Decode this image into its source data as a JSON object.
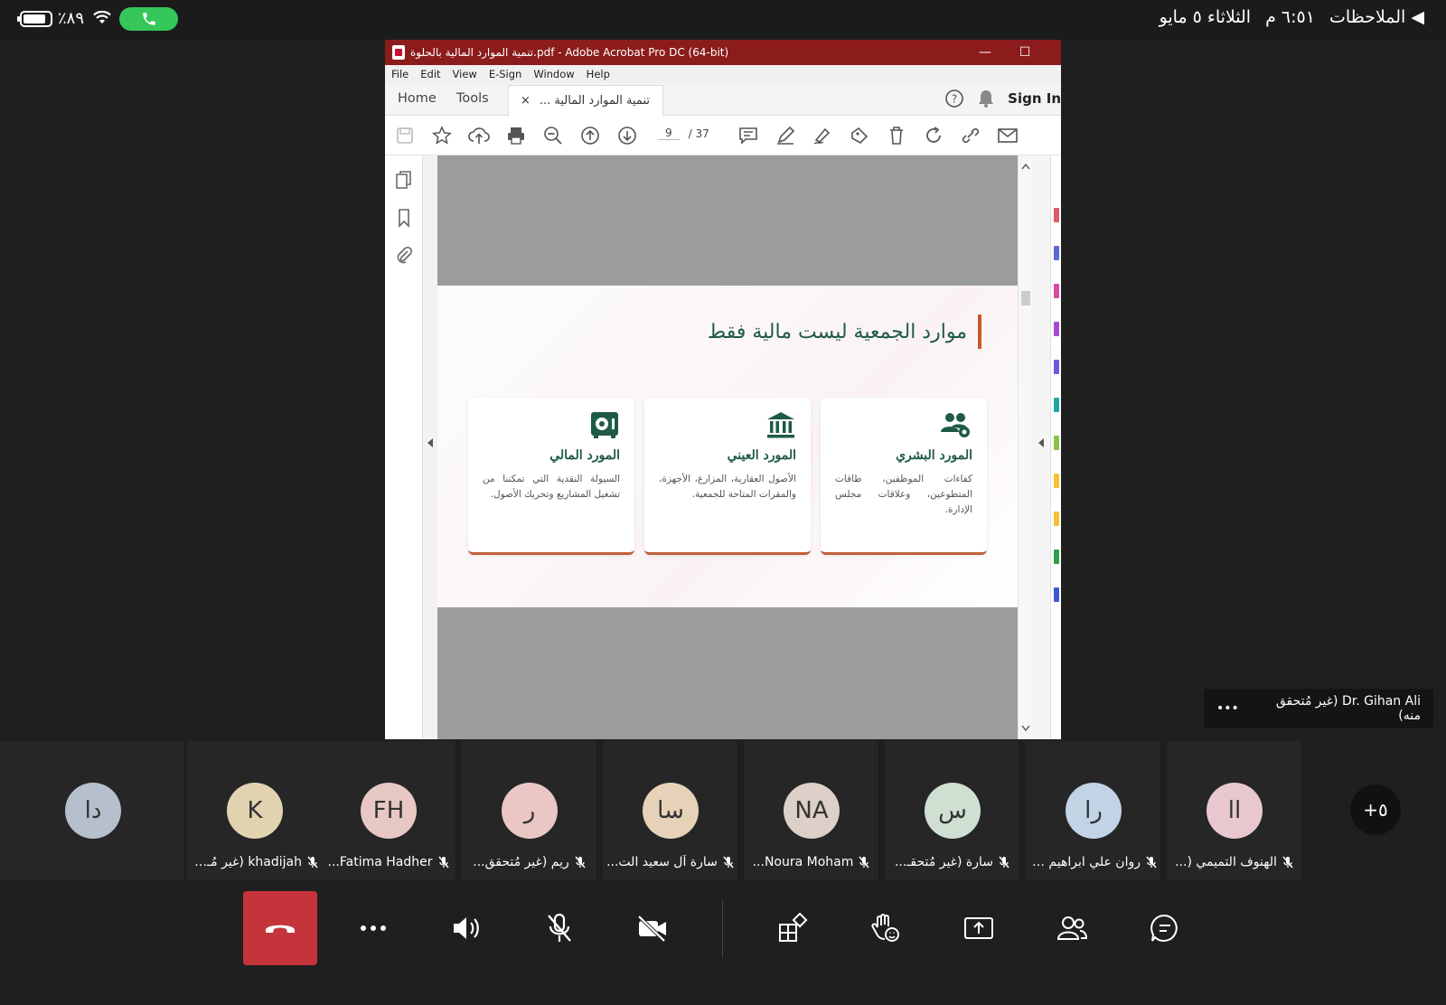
{
  "status": {
    "battery_text": "٪٨٩",
    "back_label": "◀ الملاحظات",
    "date": "الثلاثاء ٥ مايو",
    "time": "٦:٥١ م"
  },
  "acrobat": {
    "window_title": "تنمية الموارد المالية بالحلوة.pdf - Adobe Acrobat Pro DC (64-bit)",
    "menu": [
      "File",
      "Edit",
      "View",
      "E-Sign",
      "Window",
      "Help"
    ],
    "tabs": {
      "home": "Home",
      "tools": "Tools",
      "document": "تنمية الموارد المالية ...",
      "close": "×"
    },
    "sign_in": "Sign In",
    "page_current": "9",
    "page_total": "/ 37",
    "slide": {
      "title": "موارد الجمعية ليست مالية فقط",
      "cards": [
        {
          "title": "المورد البشري",
          "text": "كفاءات الموظفين، طاقات المتطوعين، وعلاقات مجلس الإدارة."
        },
        {
          "title": "المورد العيني",
          "text": "الأصول العقارية، المزارع، الأجهزة، والمقرات المتاحة للجمعية."
        },
        {
          "title": "المورد المالي",
          "text": "السيولة النقدية التي تمكننا من تشغيل المشاريع وتحريك الأصول."
        }
      ]
    }
  },
  "presenter_chip": {
    "name": "Dr. Gihan Ali (غير مُتحقق منه)",
    "more": "•••"
  },
  "participants": [
    {
      "initials": "دا",
      "name": "",
      "color": "#b5c0cc",
      "muted": false
    },
    {
      "initials": "K",
      "name": "khadijah  (غير مُـ...)",
      "color": "#e2d3b0",
      "muted": true
    },
    {
      "initials": "FH",
      "name": "Fatima Hadher...",
      "color": "#e8c8c3",
      "muted": true
    },
    {
      "initials": "ر",
      "name": "ريم (غير مُتحقق...",
      "color": "#eac7c5",
      "muted": true
    },
    {
      "initials": "سا",
      "name": "سارة آل سعيد الت...",
      "color": "#e6d2b8",
      "muted": true
    },
    {
      "initials": "NA",
      "name": "Noura Moham...",
      "color": "#ddd0c8",
      "muted": true
    },
    {
      "initials": "س",
      "name": "سارة  (غير مُتحقـ...",
      "color": "#cfe0d3",
      "muted": true
    },
    {
      "initials": "را",
      "name": "روان علي ابراهيم ا...",
      "color": "#c3d3e6",
      "muted": true
    },
    {
      "initials": "اا",
      "name": "الهنوف التميمي (...",
      "color": "#e8c7cf",
      "muted": true
    }
  ],
  "overflow_count": "+٥",
  "colors": {
    "hangup": "#c4343a",
    "call_pill": "#35c759",
    "title_bar": "#8c1c1c",
    "accent_green": "#1f5a48",
    "accent_orange": "#c0603a"
  }
}
